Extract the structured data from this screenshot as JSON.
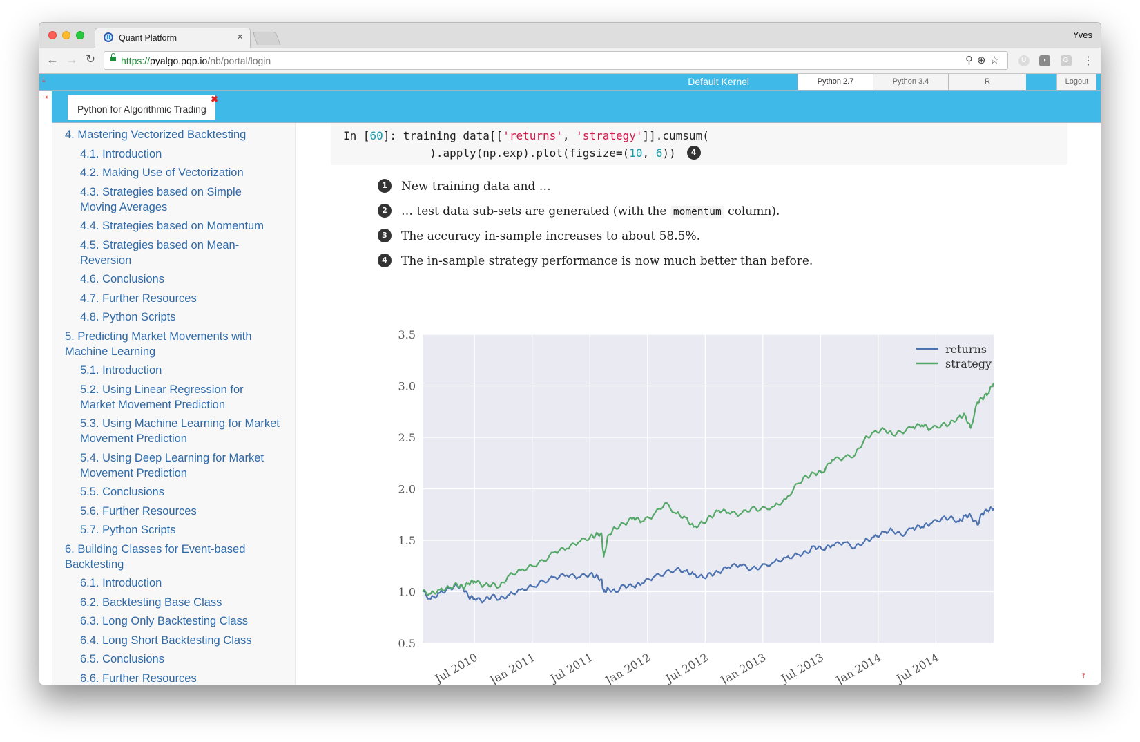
{
  "browser": {
    "tab_title": "Quant Platform",
    "tab_close": "×",
    "user": "Yves",
    "url_scheme": "https://",
    "url_host": "pyalgo.pqp.io",
    "url_path": "/nb/portal/login",
    "omnibox_icons": [
      "key-icon",
      "zoom-icon",
      "star-icon"
    ],
    "extensions": [
      {
        "name": "u-extension-icon",
        "label": "U"
      },
      {
        "name": "extension-icon",
        "label": "◗"
      },
      {
        "name": "g-extension-icon",
        "label": "G"
      }
    ],
    "menu_glyph": "⋮",
    "back_glyph": "←",
    "forward_glyph": "→",
    "reload_glyph": "C"
  },
  "kernelbar": {
    "download_glyph": "⤓",
    "label": "Default Kernel",
    "kernels": [
      "Python 2.7",
      "Python 3.4",
      "R"
    ],
    "active_kernel": "Python 2.7",
    "logout": "Logout"
  },
  "doc_tab": {
    "toggle_glyph": "⇥",
    "title": "Python for Algorithmic Trading",
    "close_glyph": "✖"
  },
  "sidebar": {
    "items": [
      {
        "level": 1,
        "label": "4. Mastering Vectorized Backtesting"
      },
      {
        "level": 2,
        "label": "4.1. Introduction"
      },
      {
        "level": 2,
        "label": "4.2. Making Use of Vectorization"
      },
      {
        "level": 2,
        "label": "4.3. Strategies based on Simple Moving Averages"
      },
      {
        "level": 2,
        "label": "4.4. Strategies based on Momentum"
      },
      {
        "level": 2,
        "label": "4.5. Strategies based on Mean-Reversion"
      },
      {
        "level": 2,
        "label": "4.6. Conclusions"
      },
      {
        "level": 2,
        "label": "4.7. Further Resources"
      },
      {
        "level": 2,
        "label": "4.8. Python Scripts"
      },
      {
        "level": 1,
        "label": "5. Predicting Market Movements with Machine Learning"
      },
      {
        "level": 2,
        "label": "5.1. Introduction"
      },
      {
        "level": 2,
        "label": "5.2. Using Linear Regression for Market Movement Prediction"
      },
      {
        "level": 2,
        "label": "5.3. Using Machine Learning for Market Movement Prediction"
      },
      {
        "level": 2,
        "label": "5.4. Using Deep Learning for Market Movement Prediction"
      },
      {
        "level": 2,
        "label": "5.5. Conclusions"
      },
      {
        "level": 2,
        "label": "5.6. Further Resources"
      },
      {
        "level": 2,
        "label": "5.7. Python Scripts"
      },
      {
        "level": 1,
        "label": "6. Building Classes for Event-based Backtesting"
      },
      {
        "level": 2,
        "label": "6.1. Introduction"
      },
      {
        "level": 2,
        "label": "6.2. Backtesting Base Class"
      },
      {
        "level": 2,
        "label": "6.3. Long Only Backtesting Class"
      },
      {
        "level": 2,
        "label": "6.4. Long Short Backtesting Class"
      },
      {
        "level": 2,
        "label": "6.5. Conclusions"
      },
      {
        "level": 2,
        "label": "6.6. Further Resources"
      }
    ]
  },
  "code_cell": {
    "prompt_prefix": "In [",
    "prompt_number": "60",
    "prompt_suffix": "]: ",
    "line1_a": "training_data[[",
    "line1_str1": "'returns'",
    "line1_b": ", ",
    "line1_str2": "'strategy'",
    "line1_c": "]].cumsum(",
    "line2_indent": "             ",
    "line2_a": ").apply(np.exp).plot(figsize=(",
    "line2_n1": "10",
    "line2_b": ", ",
    "line2_n2": "6",
    "line2_c": "))",
    "callout": "4"
  },
  "notes": [
    {
      "n": "1",
      "text": "New training data and …"
    },
    {
      "n": "2",
      "text_before": "… test data sub-sets are generated (with the ",
      "code": "momentum",
      "text_after": " column)."
    },
    {
      "n": "3",
      "text": "The accuracy in-sample increases to about 58.5%."
    },
    {
      "n": "4",
      "text": "The in-sample strategy performance is now much better than before."
    }
  ],
  "scroll_top_glyph": "⤒",
  "chart_data": {
    "type": "line",
    "title": "",
    "xlabel": "",
    "ylabel": "",
    "ylim": [
      0.5,
      3.5
    ],
    "xlim": [
      2010.05,
      2015.0
    ],
    "yticks": [
      "0.5",
      "1.0",
      "1.5",
      "2.0",
      "2.5",
      "3.0",
      "3.5"
    ],
    "ytick_values": [
      0.5,
      1.0,
      1.5,
      2.0,
      2.5,
      3.0,
      3.5
    ],
    "xticks": [
      "Jul 2010",
      "Jan 2011",
      "Jul 2011",
      "Jan 2012",
      "Jul 2012",
      "Jan 2013",
      "Jul 2013",
      "Jan 2014",
      "Jul 2014"
    ],
    "xtick_values": [
      2010.5,
      2011.0,
      2011.5,
      2012.0,
      2012.5,
      2013.0,
      2013.5,
      2014.0,
      2014.5
    ],
    "grid": true,
    "legend": "top-right",
    "x": [
      2010.05,
      2010.12,
      2010.2,
      2010.28,
      2010.35,
      2010.4,
      2010.45,
      2010.5,
      2010.58,
      2010.65,
      2010.72,
      2010.8,
      2010.9,
      2011.0,
      2011.1,
      2011.2,
      2011.3,
      2011.4,
      2011.5,
      2011.55,
      2011.6,
      2011.62,
      2011.66,
      2011.72,
      2011.8,
      2011.88,
      2011.95,
      2012.05,
      2012.15,
      2012.25,
      2012.33,
      2012.4,
      2012.48,
      2012.55,
      2012.62,
      2012.7,
      2012.8,
      2012.9,
      2012.98,
      2013.1,
      2013.2,
      2013.3,
      2013.38,
      2013.45,
      2013.52,
      2013.6,
      2013.7,
      2013.8,
      2013.88,
      2013.96,
      2014.05,
      2014.12,
      2014.2,
      2014.3,
      2014.38,
      2014.45,
      2014.55,
      2014.62,
      2014.7,
      2014.75,
      2014.8,
      2014.86,
      2014.9,
      2014.95,
      2015.0
    ],
    "series": [
      {
        "name": "returns",
        "color": "#4c72b0",
        "values": [
          1.0,
          0.93,
          0.99,
          1.03,
          1.06,
          1.04,
          0.95,
          0.93,
          0.91,
          0.96,
          0.93,
          0.97,
          1.02,
          1.05,
          1.1,
          1.14,
          1.16,
          1.14,
          1.17,
          1.15,
          1.12,
          1.0,
          1.03,
          1.0,
          1.06,
          1.05,
          1.08,
          1.14,
          1.18,
          1.22,
          1.2,
          1.17,
          1.14,
          1.17,
          1.19,
          1.24,
          1.26,
          1.22,
          1.24,
          1.29,
          1.33,
          1.36,
          1.38,
          1.44,
          1.41,
          1.45,
          1.48,
          1.43,
          1.49,
          1.53,
          1.58,
          1.6,
          1.55,
          1.62,
          1.63,
          1.66,
          1.71,
          1.72,
          1.68,
          1.74,
          1.74,
          1.65,
          1.76,
          1.79,
          1.81
        ]
      },
      {
        "name": "strategy",
        "color": "#55a868",
        "values": [
          1.0,
          0.98,
          1.02,
          1.04,
          1.07,
          1.04,
          1.08,
          1.1,
          1.06,
          1.07,
          1.05,
          1.16,
          1.21,
          1.25,
          1.3,
          1.39,
          1.42,
          1.48,
          1.53,
          1.55,
          1.57,
          1.34,
          1.55,
          1.62,
          1.66,
          1.72,
          1.68,
          1.74,
          1.86,
          1.76,
          1.72,
          1.63,
          1.67,
          1.73,
          1.79,
          1.77,
          1.75,
          1.81,
          1.8,
          1.83,
          1.9,
          2.05,
          2.12,
          2.15,
          2.16,
          2.28,
          2.3,
          2.33,
          2.48,
          2.55,
          2.58,
          2.53,
          2.55,
          2.6,
          2.62,
          2.58,
          2.62,
          2.63,
          2.7,
          2.72,
          2.59,
          2.84,
          2.88,
          2.92,
          3.03
        ]
      }
    ]
  }
}
